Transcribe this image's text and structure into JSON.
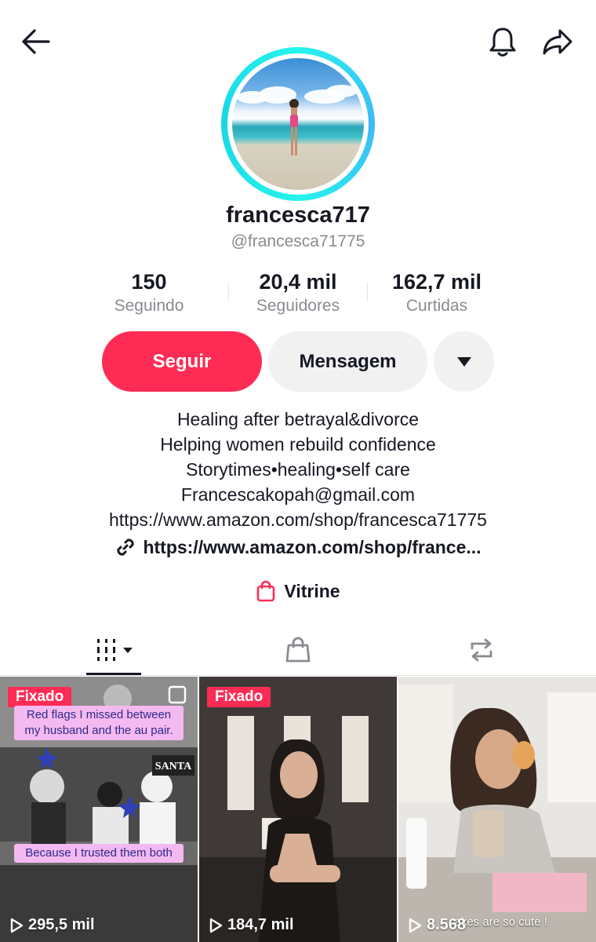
{
  "profile": {
    "display_name": "francesca717",
    "handle": "@francesca71775"
  },
  "stats": [
    {
      "value": "150",
      "label": "Seguindo"
    },
    {
      "value": "20,4 mil",
      "label": "Seguidores"
    },
    {
      "value": "162,7 mil",
      "label": "Curtidas"
    }
  ],
  "actions": {
    "follow_label": "Seguir",
    "message_label": "Mensagem"
  },
  "bio": [
    "Healing after betrayal&divorce",
    "Helping women rebuild confidence",
    "Storytimes•healing•self care",
    "Francescakopah@gmail.com",
    "https://www.amazon.com/shop/francesca71775"
  ],
  "bio_link": "https://www.amazon.com/shop/france...",
  "showcase_label": "Vitrine",
  "tabs": [
    {
      "icon": "videos-grid-icon",
      "active": true
    },
    {
      "icon": "shopping-bag-icon",
      "active": false
    },
    {
      "icon": "repost-icon",
      "active": false
    }
  ],
  "videos": [
    {
      "pinned_label": "Fixado",
      "views": "295,5 mil",
      "caption_top": "Red flags I missed between my husband and the au pair.",
      "caption_bottom": "Because I trusted them both",
      "sign_text": "SANTA"
    },
    {
      "pinned_label": "Fixado",
      "views": "184,7 mil"
    },
    {
      "views": "8.568",
      "overlay": "cakes are so cute !"
    }
  ],
  "colors": {
    "accent": "#fe2c55",
    "ring": "#25f4ee",
    "text_primary": "#161823",
    "text_secondary": "#8a8b91",
    "button_grey": "#f1f1f2"
  }
}
